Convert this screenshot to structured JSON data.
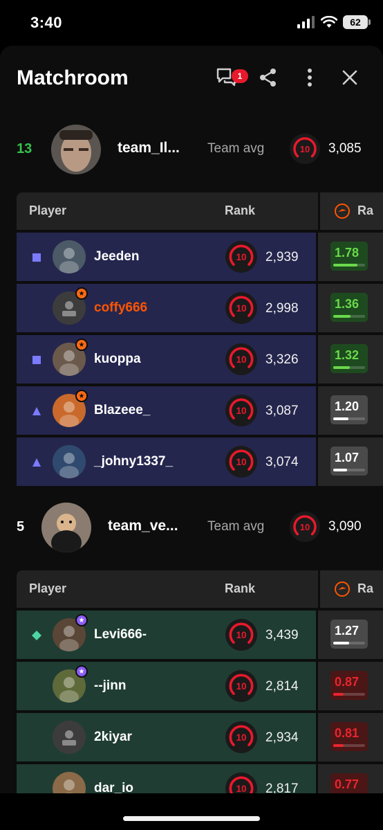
{
  "status_bar": {
    "time": "3:40",
    "battery": "62"
  },
  "header": {
    "title": "Matchroom",
    "notification_count": "1"
  },
  "columns": {
    "player": "Player",
    "rank": "Rank",
    "rating": "Ra"
  },
  "colors": {
    "level_red": "#e8192c",
    "faceit_orange": "#ff5500",
    "team_a_row": "#25264e",
    "team_b_row": "#1f3d33"
  },
  "team_a": {
    "score": "13",
    "score_color": "#36c24a",
    "name": "team_Il...",
    "avg_label": "Team avg",
    "avg_level": "10",
    "avg_elo": "3,085",
    "players": [
      {
        "name": "Jeeden",
        "level": "10",
        "elo": "2,939",
        "kd": "1.78",
        "kd_fill": 0.75,
        "kd_class": "good",
        "party": "square",
        "badge": ""
      },
      {
        "name": "coffy666",
        "level": "10",
        "elo": "2,998",
        "kd": "1.36",
        "kd_fill": 0.55,
        "kd_class": "good",
        "party": "",
        "badge": "star-orange",
        "name_color": "orange"
      },
      {
        "name": "kuoppa",
        "level": "10",
        "elo": "3,326",
        "kd": "1.32",
        "kd_fill": 0.53,
        "kd_class": "good",
        "party": "square",
        "badge": "star-orange"
      },
      {
        "name": "Blazeee_",
        "level": "10",
        "elo": "3,087",
        "kd": "1.20",
        "kd_fill": 0.48,
        "kd_class": "neutral",
        "party": "triangle",
        "badge": "star-orange"
      },
      {
        "name": "_johny1337_",
        "level": "10",
        "elo": "3,074",
        "kd": "1.07",
        "kd_fill": 0.43,
        "kd_class": "neutral",
        "party": "triangle",
        "badge": ""
      }
    ]
  },
  "team_b": {
    "score": "5",
    "score_color": "#ffffff",
    "name": "team_ve...",
    "avg_label": "Team avg",
    "avg_level": "10",
    "avg_elo": "3,090",
    "players": [
      {
        "name": "Levi666-",
        "level": "10",
        "elo": "3,439",
        "kd": "1.27",
        "kd_fill": 0.5,
        "kd_class": "neutral",
        "party": "diamond",
        "badge": "star-purple"
      },
      {
        "name": "--jinn",
        "level": "10",
        "elo": "2,814",
        "kd": "0.87",
        "kd_fill": 0.33,
        "kd_class": "bad",
        "party": "",
        "badge": "star-purple"
      },
      {
        "name": "2kiyar",
        "level": "10",
        "elo": "2,934",
        "kd": "0.81",
        "kd_fill": 0.32,
        "kd_class": "bad",
        "party": "",
        "badge": ""
      },
      {
        "name": "dar_io",
        "level": "10",
        "elo": "2,817",
        "kd": "0.77",
        "kd_fill": 0.3,
        "kd_class": "bad",
        "party": "",
        "badge": ""
      }
    ]
  }
}
